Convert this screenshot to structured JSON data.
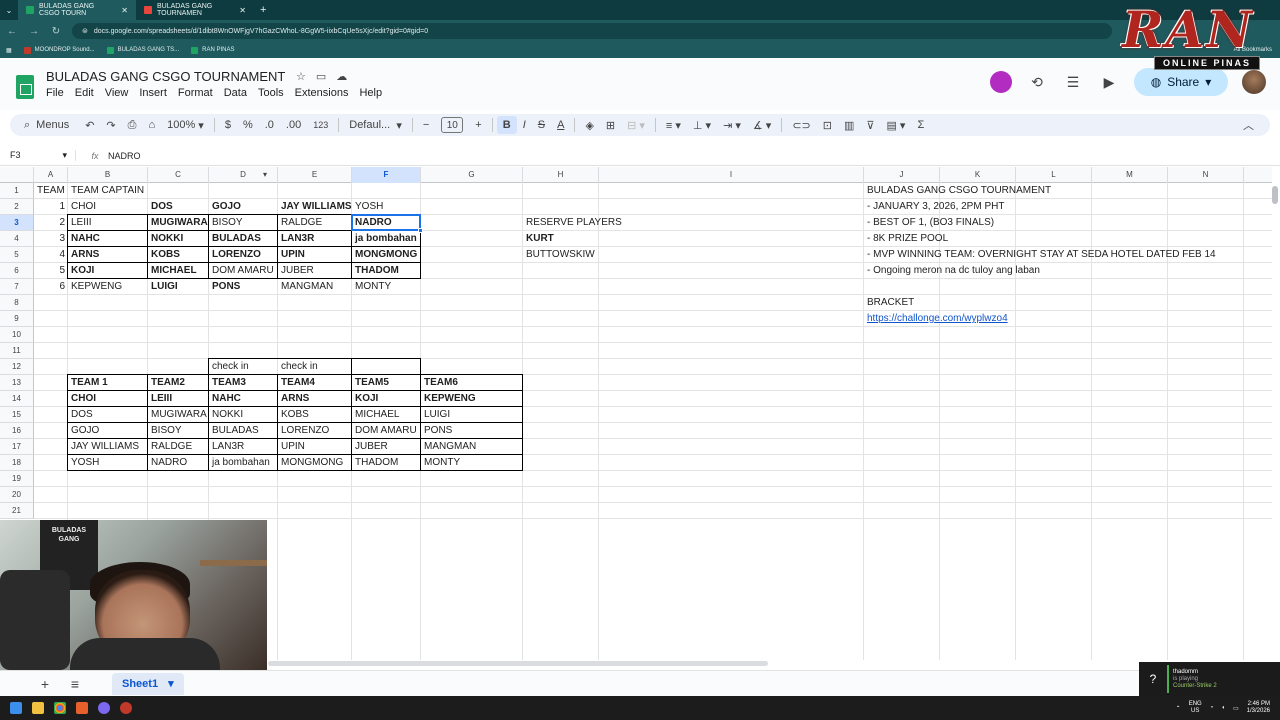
{
  "browser": {
    "tabs": [
      {
        "title": "BULADAS GANG CSGO TOURN",
        "active": true
      },
      {
        "title": "BULADAS GANG TOURNAMEN",
        "active": false
      }
    ],
    "url": "docs.google.com/spreadsheets/d/1dibt8WnOWFjgV7hGazCWhoL-8GgW5-iixbCqUe5sXjc/edit?gid=0#gid=0",
    "bookmarks": [
      "MOONDROP Sound...",
      "BULADAS GANG TS...",
      "RAN PINAS"
    ],
    "all_bookmarks": "All Bookmarks"
  },
  "overlay": {
    "logo_letters": "RAN",
    "logo_banner": "ONLINE PINAS"
  },
  "doc": {
    "title": "BULADAS GANG CSGO TOURNAMENT",
    "menu": [
      "File",
      "Edit",
      "View",
      "Insert",
      "Format",
      "Data",
      "Tools",
      "Extensions",
      "Help"
    ],
    "share_label": "Share"
  },
  "toolbar": {
    "menus_label": "Menus",
    "zoom": "100%",
    "currency": "$",
    "percent": "%",
    "dec_decrease": ".0",
    "dec_increase": ".00",
    "number_format": "123",
    "font": "Defaul...",
    "font_size": "10",
    "bold": "B",
    "italic": "I",
    "strike": "S",
    "text_color": "A"
  },
  "formula_bar": {
    "cell_ref": "F3",
    "fx": "fx",
    "value": "NADRO"
  },
  "columns": [
    "A",
    "B",
    "C",
    "D",
    "E",
    "F",
    "G",
    "H",
    "I",
    "J",
    "K",
    "L",
    "M",
    "N"
  ],
  "rows": [
    "1",
    "2",
    "3",
    "4",
    "5",
    "6",
    "7",
    "8",
    "9",
    "10",
    "11",
    "12",
    "13",
    "14",
    "15",
    "16",
    "17",
    "18",
    "19",
    "20",
    "21"
  ],
  "roster": {
    "headers": [
      "TEAM",
      "TEAM CAPTAIN"
    ],
    "teams": [
      {
        "num": "1",
        "members": [
          "CHOI",
          "DOS",
          "GOJO",
          "JAY WILLIAMS",
          "YOSH"
        ]
      },
      {
        "num": "2",
        "members": [
          "LEIII",
          "MUGIWARA",
          "BISOY",
          "RALDGE",
          "NADRO"
        ]
      },
      {
        "num": "3",
        "members": [
          "NAHC",
          "NOKKI",
          "BULADAS",
          "LAN3R",
          "ja bombahan"
        ]
      },
      {
        "num": "4",
        "members": [
          "ARNS",
          "KOBS",
          "LORENZO",
          "UPIN",
          "MONGMONG"
        ]
      },
      {
        "num": "5",
        "members": [
          "KOJI",
          "MICHAEL",
          "DOM AMARU",
          "JUBER",
          "THADOM"
        ]
      },
      {
        "num": "6",
        "members": [
          "KEPWENG",
          "LUIGI",
          "PONS",
          "MANGMAN",
          "MONTY"
        ]
      }
    ]
  },
  "reserve": {
    "title": "RESERVE PLAYERS",
    "players": [
      "KURT",
      "BUTTOWSKIW"
    ]
  },
  "info": {
    "lines": [
      "BULADAS GANG  CSGO TOURNAMENT",
      "- JANUARY 3, 2026, 2PM PHT",
      "- BEST OF 1, (BO3 FINALS)",
      "- 8K PRIZE POOL",
      "- MVP WINNING TEAM: OVERNIGHT STAY AT SEDA HOTEL DATED FEB 14",
      "- Ongoing meron na dc tuloy ang laban"
    ],
    "bracket_label": "BRACKET",
    "bracket_link": "https://challonge.com/wyplwzo4"
  },
  "checkin": [
    "check in",
    "check in"
  ],
  "team_table": {
    "headers": [
      "TEAM 1",
      "TEAM2",
      "TEAM3",
      "TEAM4",
      "TEAM5",
      "TEAM6"
    ],
    "rows": [
      [
        "CHOI",
        "LEIII",
        "NAHC",
        "ARNS",
        "KOJI",
        "KEPWENG"
      ],
      [
        "DOS",
        "MUGIWARA",
        "NOKKI",
        "KOBS",
        "MICHAEL",
        "LUIGI"
      ],
      [
        "GOJO",
        "BISOY",
        "BULADAS",
        "LORENZO",
        "DOM AMARU",
        "PONS"
      ],
      [
        "JAY WILLIAMS",
        "RALDGE",
        "LAN3R",
        "UPIN",
        "JUBER",
        "MANGMAN"
      ],
      [
        "YOSH",
        "NADRO",
        "ja bombahan",
        "MONGMONG",
        "THADOM",
        "MONTY"
      ]
    ]
  },
  "webcam": {
    "poster_text": "BULADAS GANG"
  },
  "sheet_tab": "Sheet1",
  "now_playing": {
    "name": "thadomm",
    "status": "is playing",
    "game": "Counter-Strike 2"
  },
  "tray": {
    "lang": "ENG",
    "region": "US",
    "time": "2:46 PM",
    "date": "1/3/2026"
  }
}
